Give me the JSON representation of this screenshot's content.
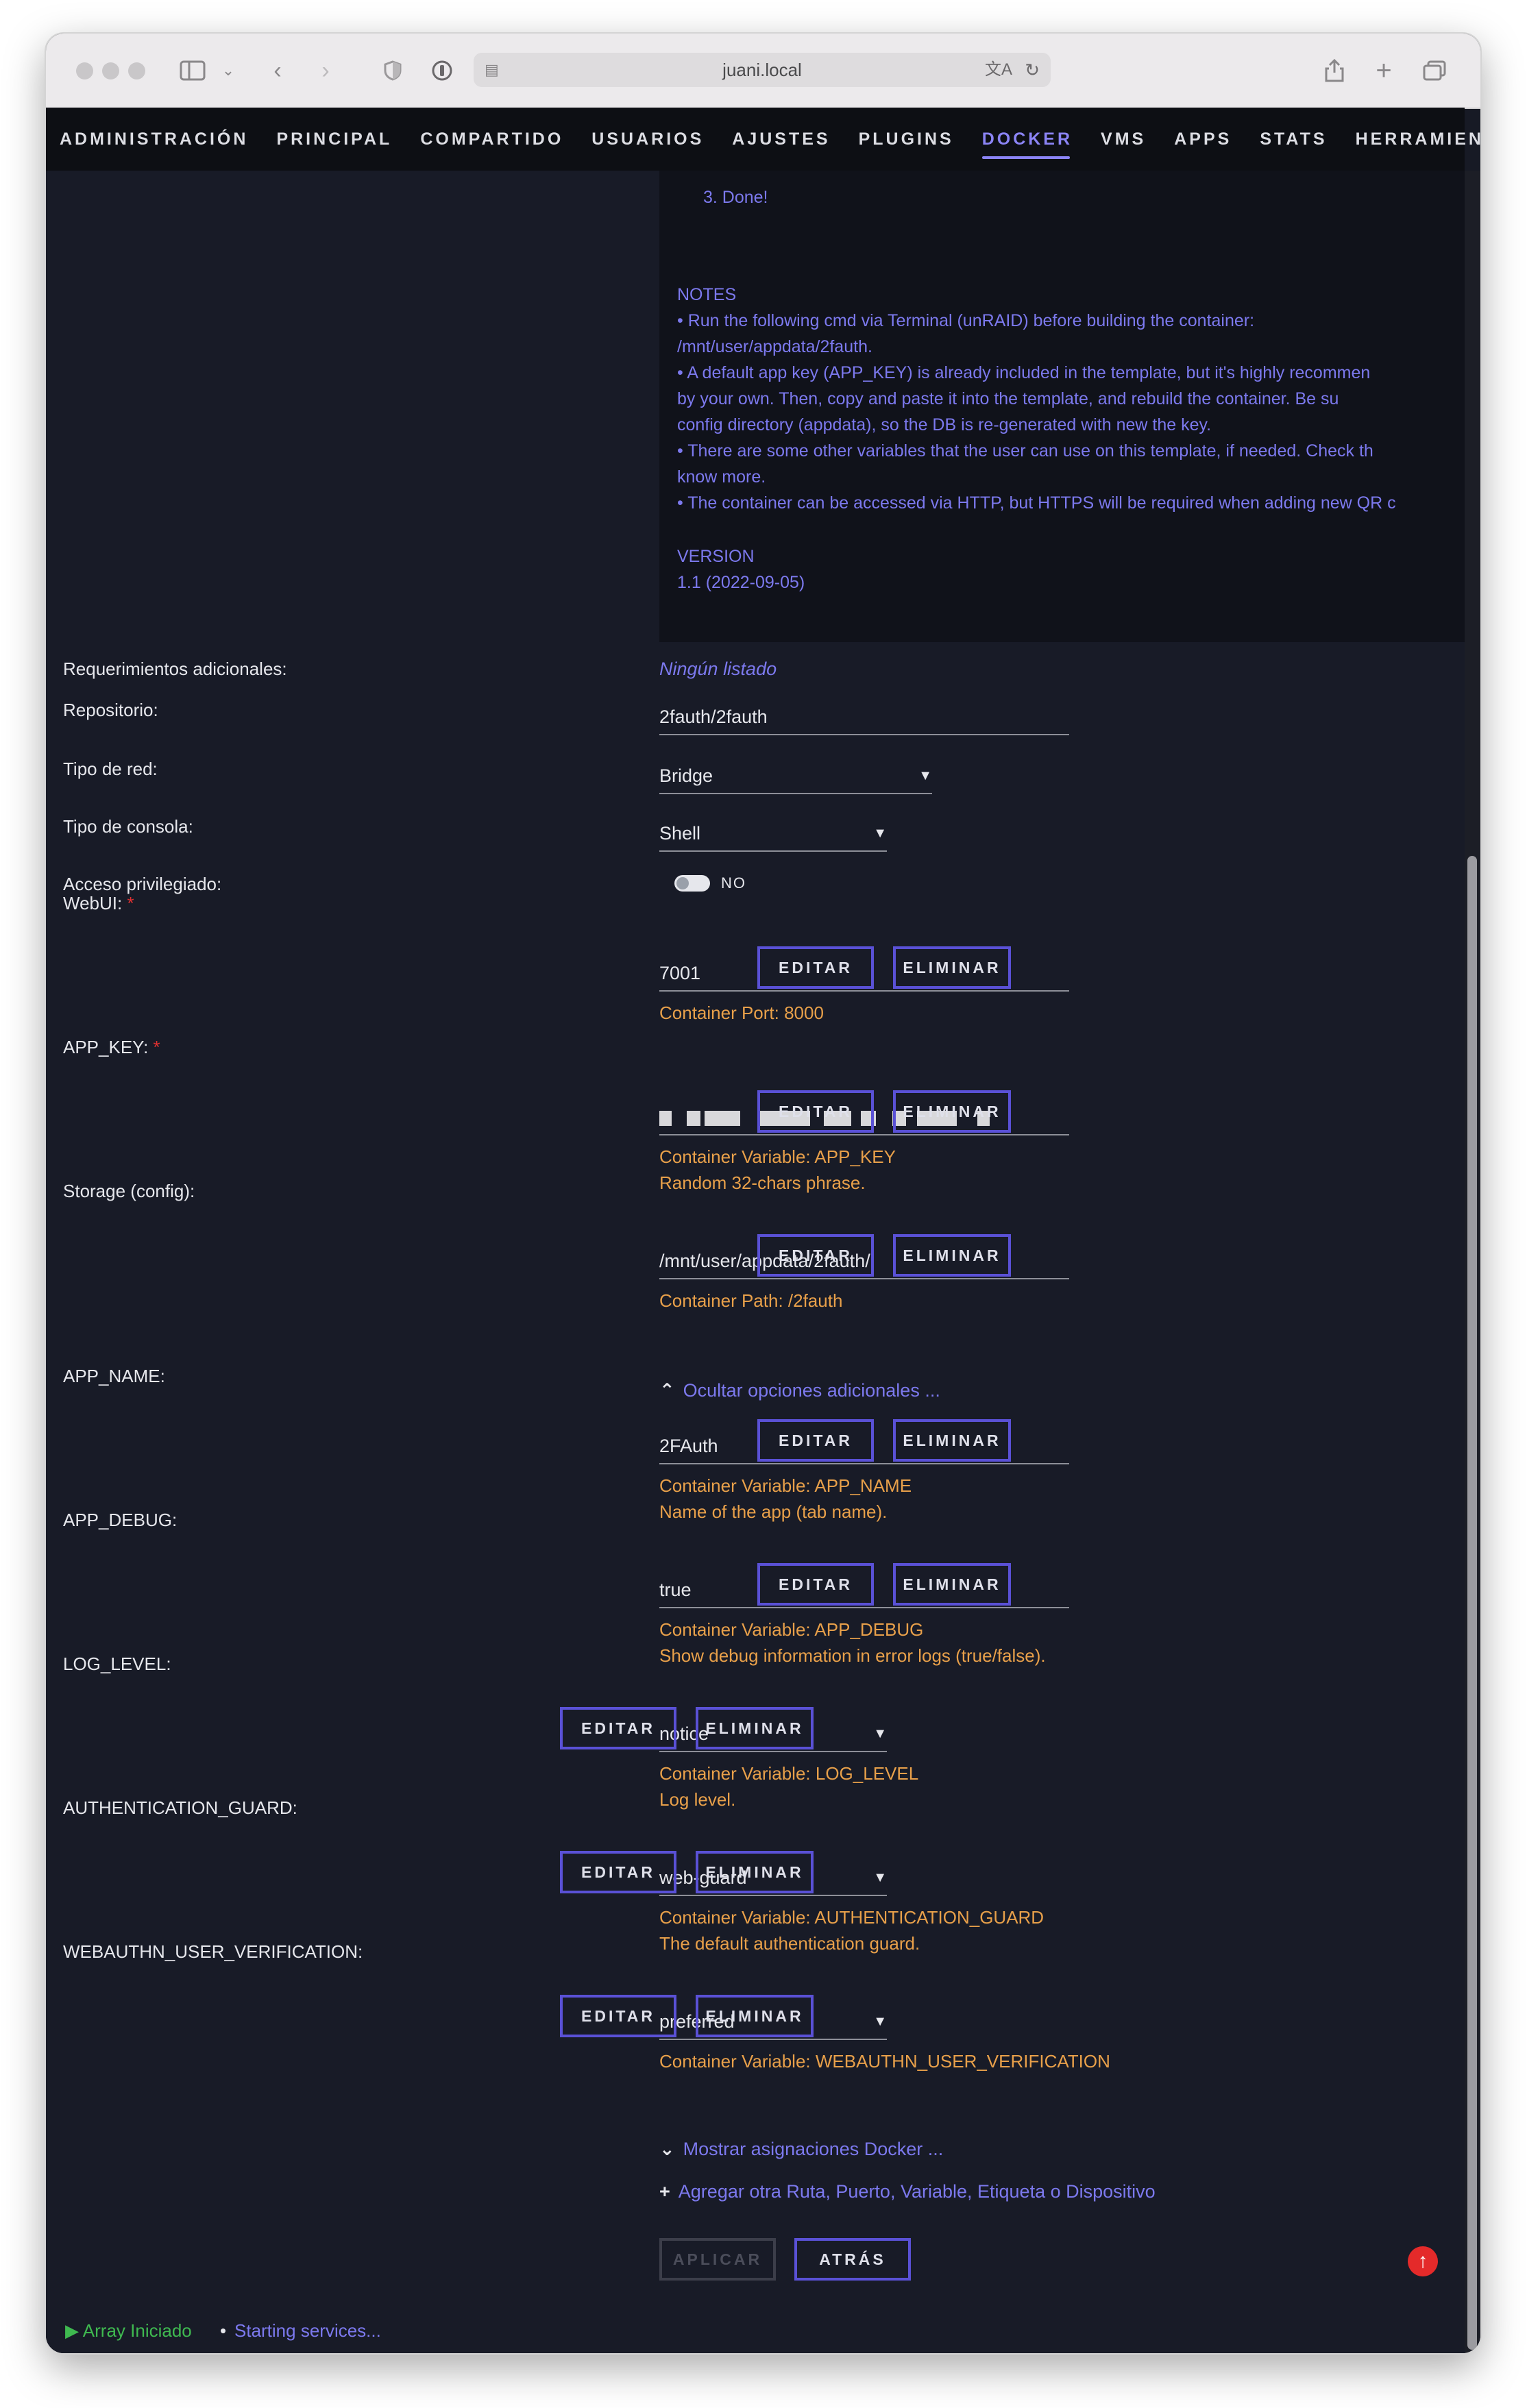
{
  "browser": {
    "url": "juani.local",
    "translate_icon": "translate-icon",
    "reload_icon": "reload-icon"
  },
  "nav": {
    "items": [
      "ADMINISTRACIÓN",
      "PRINCIPAL",
      "COMPARTIDO",
      "USUARIOS",
      "AJUSTES",
      "PLUGINS",
      "DOCKER",
      "VMS",
      "APPS",
      "STATS",
      "HERRAMIENTAS"
    ],
    "active": "DOCKER"
  },
  "overview": {
    "done_step": "3.  Done!",
    "notes_title": "NOTES",
    "notes_lines": [
      "• Run the following cmd via Terminal (unRAID) before building the container:",
      "/mnt/user/appdata/2fauth.",
      "• A default app key (APP_KEY) is already included in the template, but it's highly recommen",
      "by your own. Then, copy and paste it into the template, and rebuild the container. Be su",
      "config directory (appdata), so the DB is re-generated with new the key.",
      "• There are some other variables that the user can use on this template, if needed. Check th",
      "know more.",
      "• The container can be accessed via HTTP, but HTTPS will be required when adding new QR c"
    ],
    "version_title": "VERSION",
    "version_value": "1.1 (2022-09-05)"
  },
  "form": {
    "requerimientos_label": "Requerimientos adicionales:",
    "requerimientos_value": "Ningún listado",
    "repositorio_label": "Repositorio:",
    "repositorio_value": "2fauth/2fauth",
    "red_label": "Tipo de red:",
    "red_value": "Bridge",
    "consola_label": "Tipo de consola:",
    "consola_value": "Shell",
    "privilegiado_label": "Acceso privilegiado:",
    "privilegiado_value": "NO"
  },
  "buttons": {
    "edit": "EDITAR",
    "delete": "ELIMINAR",
    "apply": "APLICAR",
    "back": "ATRÁS"
  },
  "config": [
    {
      "label": "WebUI:",
      "required": true,
      "value": "7001",
      "hint1": "Container Port: 8000",
      "hint2": ""
    },
    {
      "label": "APP_KEY:",
      "required": true,
      "value": "",
      "hint1": "Container Variable: APP_KEY",
      "hint2": "Random 32-chars phrase."
    },
    {
      "label": "Storage (config):",
      "required": false,
      "value": "/mnt/user/appdata/2fauth/",
      "hint1": "Container Path: /2fauth",
      "hint2": ""
    },
    {
      "label": "APP_NAME:",
      "required": false,
      "value": "2FAuth",
      "hint1": "Container Variable: APP_NAME",
      "hint2": "Name of the app (tab name)."
    },
    {
      "label": "APP_DEBUG:",
      "required": false,
      "value": "true",
      "hint1": "Container Variable: APP_DEBUG",
      "hint2": "Show debug information in error logs (true/false)."
    },
    {
      "label": "LOG_LEVEL:",
      "required": false,
      "value": "notice",
      "hint1": "Container Variable: LOG_LEVEL",
      "hint2": "Log level."
    },
    {
      "label": "AUTHENTICATION_GUARD:",
      "required": false,
      "value": "web-guard",
      "hint1": "Container Variable: AUTHENTICATION_GUARD",
      "hint2": "The default authentication guard."
    },
    {
      "label": "WEBAUTHN_USER_VERIFICATION:",
      "required": false,
      "value": "preferred",
      "hint1": "Container Variable: WEBAUTHN_USER_VERIFICATION",
      "hint2": ""
    }
  ],
  "links": {
    "hide_more": "Ocultar opciones adicionales ...",
    "show_docker": "Mostrar asignaciones Docker ...",
    "add_more": "Agregar otra Ruta, Puerto, Variable, Etiqueta o Dispositivo"
  },
  "footer": {
    "array_status": "Array Iniciado",
    "separator": "•",
    "services_status": "Starting services..."
  },
  "colors": {
    "accent": "#7c79ee",
    "hint": "#e8a04a",
    "background": "#181b27",
    "status_ok": "#3fb950"
  }
}
